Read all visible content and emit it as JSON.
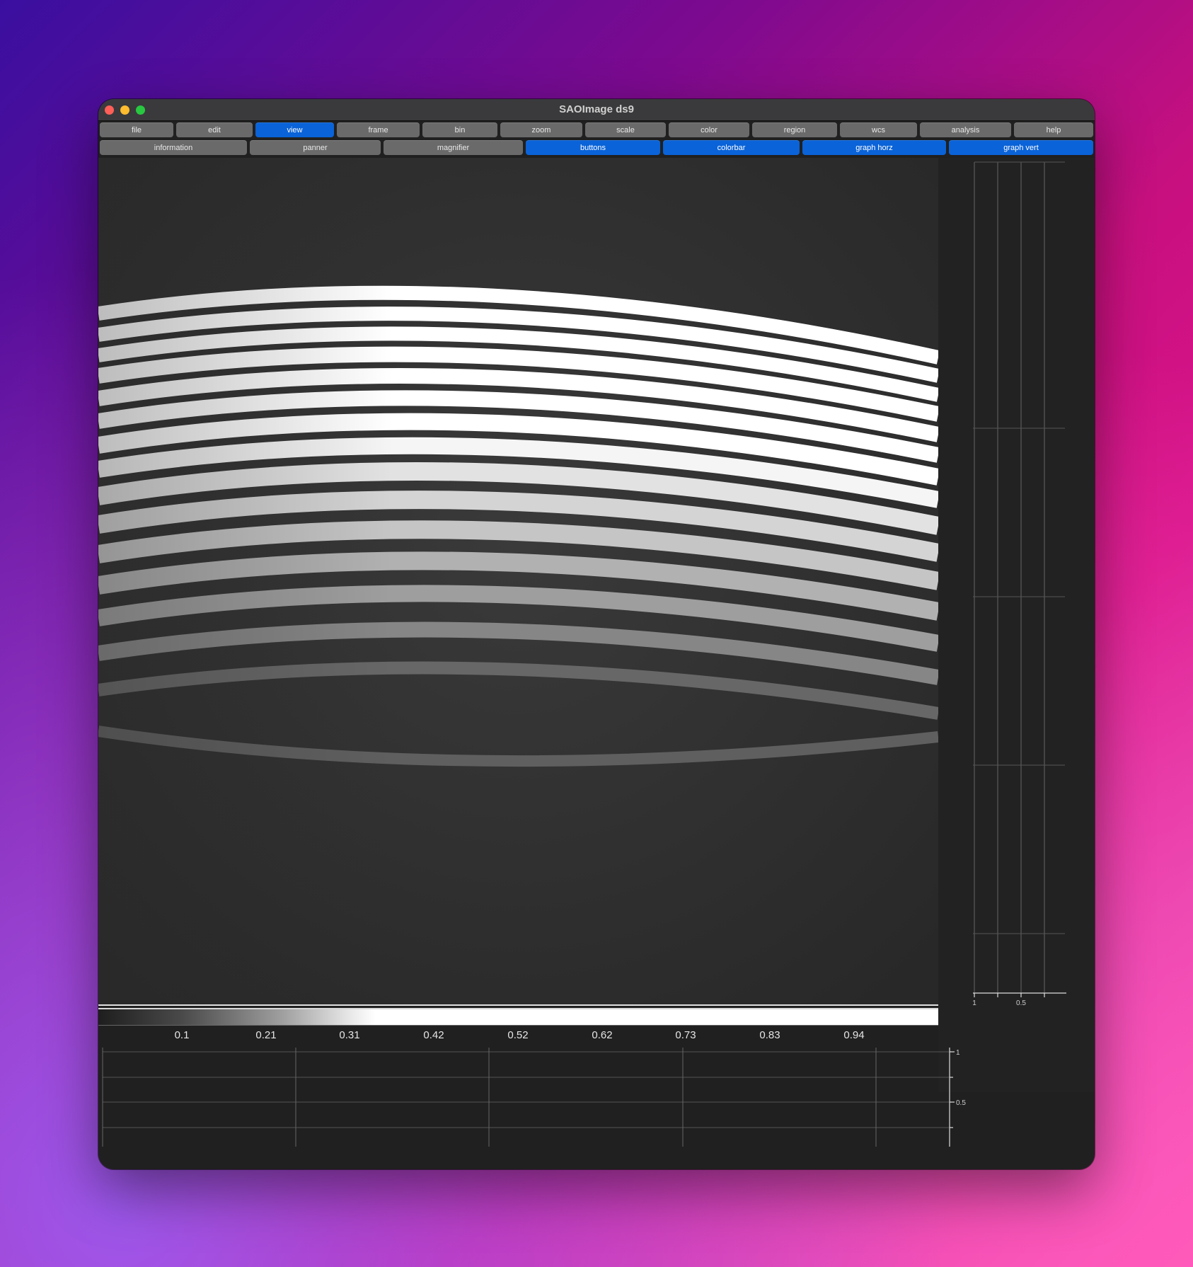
{
  "window": {
    "title": "SAOImage ds9"
  },
  "menu_row": [
    {
      "label": "file",
      "active": false
    },
    {
      "label": "edit",
      "active": false
    },
    {
      "label": "view",
      "active": true
    },
    {
      "label": "frame",
      "active": false
    },
    {
      "label": "bin",
      "active": false
    },
    {
      "label": "zoom",
      "active": false
    },
    {
      "label": "scale",
      "active": false
    },
    {
      "label": "color",
      "active": false
    },
    {
      "label": "region",
      "active": false
    },
    {
      "label": "wcs",
      "active": false
    },
    {
      "label": "analysis",
      "active": false
    },
    {
      "label": "help",
      "active": false
    }
  ],
  "view_row": [
    {
      "label": "information",
      "active": false
    },
    {
      "label": "panner",
      "active": false
    },
    {
      "label": "magnifier",
      "active": false
    },
    {
      "label": "buttons",
      "active": true
    },
    {
      "label": "colorbar",
      "active": true
    },
    {
      "label": "graph horz",
      "active": true
    },
    {
      "label": "graph vert",
      "active": true
    }
  ],
  "colorbar": {
    "ticks": [
      "0.1",
      "0.21",
      "0.31",
      "0.42",
      "0.52",
      "0.62",
      "0.73",
      "0.83",
      "0.94"
    ]
  },
  "graph_vert": {
    "ticks": [
      "1",
      "0.5"
    ]
  },
  "graph_horz": {
    "ticks": [
      "1",
      "0.5"
    ]
  },
  "colors": {
    "accent": "#0a63d8",
    "button": "#6a6a6a",
    "panel": "#202020"
  }
}
